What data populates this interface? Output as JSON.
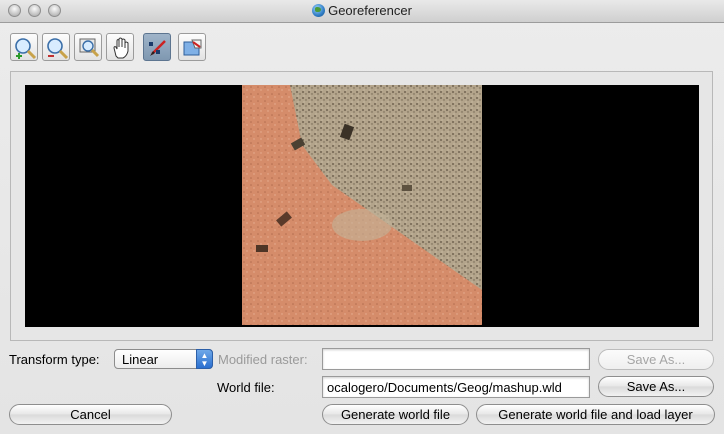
{
  "window": {
    "title": "Georeferencer"
  },
  "toolbar": {
    "tools": [
      {
        "name": "zoom-in-tool",
        "label": "Zoom in"
      },
      {
        "name": "zoom-out-tool",
        "label": "Zoom out"
      },
      {
        "name": "zoom-to-layer-tool",
        "label": "Zoom to layer"
      },
      {
        "name": "pan-tool",
        "label": "Pan"
      },
      {
        "name": "add-point-tool",
        "label": "Add point",
        "active": true
      },
      {
        "name": "delete-point-tool",
        "label": "Delete point"
      }
    ]
  },
  "form": {
    "transform_type_label": "Transform type:",
    "transform_type_value": "Linear",
    "modified_raster_label": "Modified raster:",
    "modified_raster_value": "",
    "modified_raster_save_as": "Save As...",
    "world_file_label": "World file:",
    "world_file_value": "ocalogero/Documents/Geog/mashup.wld",
    "world_file_save_as": "Save As..."
  },
  "buttons": {
    "cancel": "Cancel",
    "generate_world_file": "Generate world file",
    "generate_and_load": "Generate world file and load layer"
  },
  "colors": {
    "canvas_background": "#000000",
    "active_tool": "#8aa3bc",
    "select_arrow": "#3b7fd8"
  }
}
